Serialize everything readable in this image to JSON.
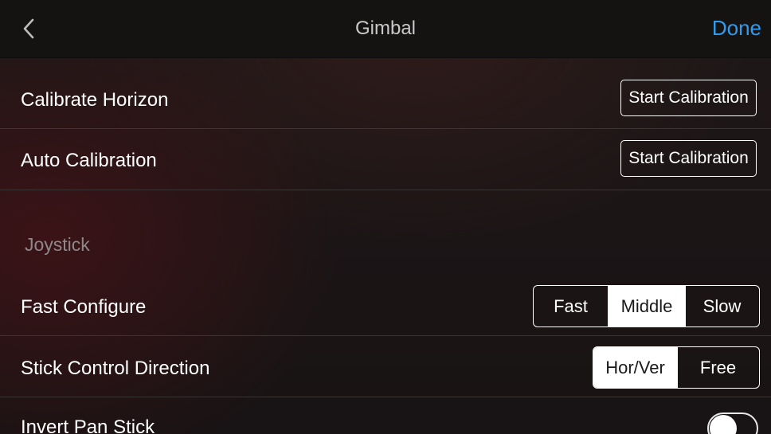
{
  "header": {
    "title": "Gimbal",
    "done_label": "Done",
    "back_icon": "chevron-left-icon"
  },
  "rows": {
    "calibrate_horizon": {
      "label": "Calibrate Horizon",
      "button": "Start Calibration"
    },
    "auto_calibration": {
      "label": "Auto Calibration",
      "button": "Start Calibration"
    }
  },
  "joystick": {
    "section_title": "Joystick",
    "fast_configure": {
      "label": "Fast Configure",
      "options": [
        "Fast",
        "Middle",
        "Slow"
      ],
      "selected": "Middle"
    },
    "stick_control_direction": {
      "label": "Stick Control Direction",
      "options": [
        "Hor/Ver",
        "Free"
      ],
      "selected": "Hor/Ver"
    },
    "invert_pan_stick": {
      "label": "Invert Pan Stick",
      "enabled": false
    }
  },
  "colors": {
    "accent": "#2f9cf0",
    "section_text": "#8e8888"
  }
}
